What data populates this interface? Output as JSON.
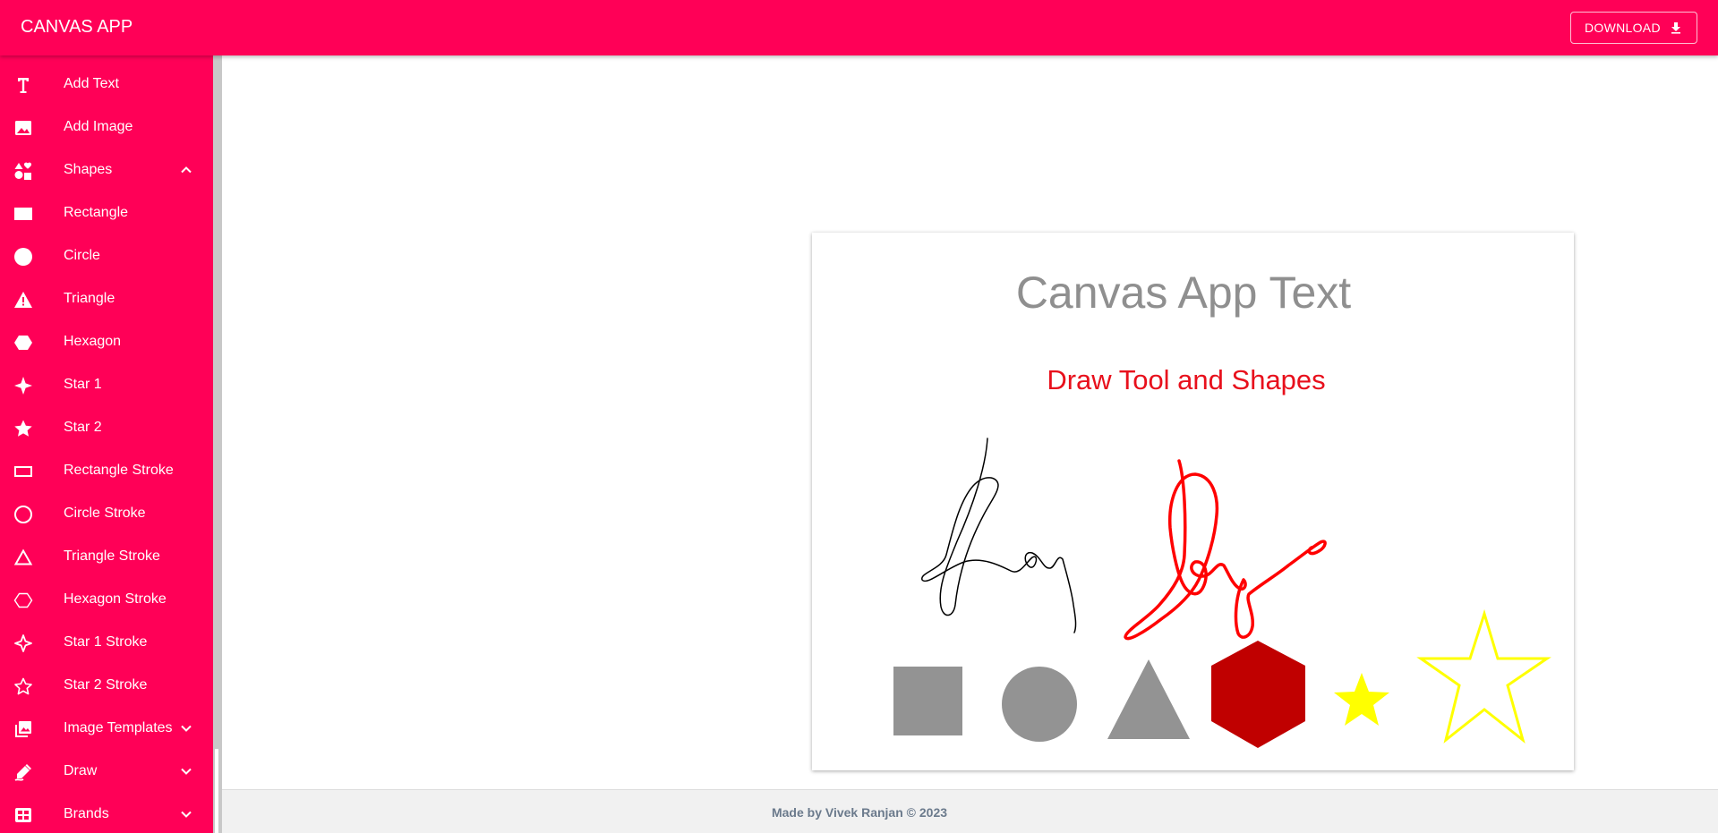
{
  "app": {
    "title": "CANVAS APP",
    "accent_color": "#ff0057"
  },
  "header": {
    "download_label": "DOWNLOAD",
    "download_icon": "download-icon"
  },
  "sidebar": {
    "items": [
      {
        "label": "Add Text",
        "icon": "text-icon"
      },
      {
        "label": "Add Image",
        "icon": "image-icon"
      },
      {
        "label": "Shapes",
        "icon": "shapes-icon",
        "expanded": true
      },
      {
        "label": "Rectangle",
        "icon": "rectangle-icon"
      },
      {
        "label": "Circle",
        "icon": "circle-icon"
      },
      {
        "label": "Triangle",
        "icon": "triangle-icon"
      },
      {
        "label": "Hexagon",
        "icon": "hexagon-icon"
      },
      {
        "label": "Star 1",
        "icon": "star-1-icon"
      },
      {
        "label": "Star 2",
        "icon": "star-2-icon"
      },
      {
        "label": "Rectangle Stroke",
        "icon": "rectangle-stroke-icon"
      },
      {
        "label": "Circle Stroke",
        "icon": "circle-stroke-icon"
      },
      {
        "label": "Triangle Stroke",
        "icon": "triangle-stroke-icon"
      },
      {
        "label": "Hexagon Stroke",
        "icon": "hexagon-stroke-icon"
      },
      {
        "label": "Star 1 Stroke",
        "icon": "star-1-stroke-icon"
      },
      {
        "label": "Star 2 Stroke",
        "icon": "star-2-stroke-icon"
      },
      {
        "label": "Image Templates",
        "icon": "image-templates-icon",
        "expanded": false
      },
      {
        "label": "Draw",
        "icon": "draw-icon",
        "expanded": false
      },
      {
        "label": "Brands",
        "icon": "brands-icon",
        "expanded": false
      }
    ]
  },
  "canvas": {
    "title_text": "Canvas App Text",
    "subtitle_text": "Draw Tool and Shapes",
    "title_color": "#8f8f8f",
    "subtitle_color": "#e8101c",
    "shape_colors": {
      "rectangle": "#939393",
      "circle": "#939393",
      "triangle": "#939393",
      "hexagon": "#c00000",
      "star_1": "#ffff00",
      "star_2_stroke": "#ffff00",
      "drawing_black": "#000000",
      "drawing_red": "#ff0000"
    }
  },
  "footer": {
    "text": "Made by Vivek Ranjan © 2023"
  }
}
